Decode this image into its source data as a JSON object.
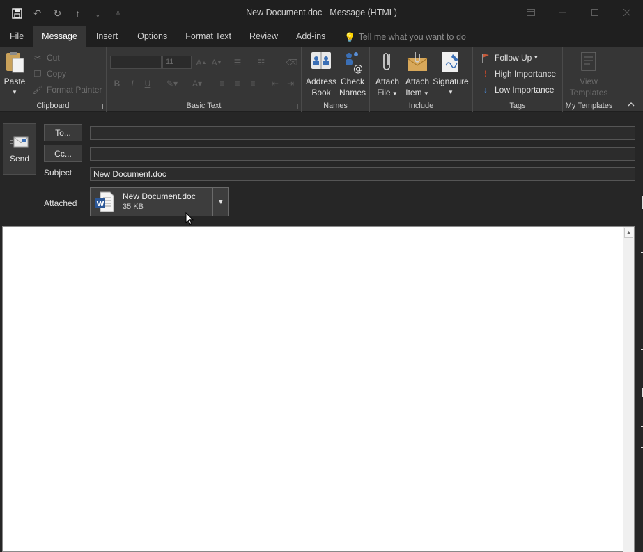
{
  "window": {
    "title": "New Document.doc  -  Message (HTML)"
  },
  "tabs": [
    {
      "label": "File"
    },
    {
      "label": "Message"
    },
    {
      "label": "Insert"
    },
    {
      "label": "Options"
    },
    {
      "label": "Format Text"
    },
    {
      "label": "Review"
    },
    {
      "label": "Add-ins"
    }
  ],
  "tell_me": "Tell me what you want to do",
  "ribbon": {
    "clipboard": {
      "label": "Clipboard",
      "paste": "Paste",
      "cut": "Cut",
      "copy": "Copy",
      "format_painter": "Format Painter"
    },
    "basic_text": {
      "label": "Basic Text",
      "font_size": "11"
    },
    "names": {
      "label": "Names",
      "address_book_1": "Address",
      "address_book_2": "Book",
      "check_names_1": "Check",
      "check_names_2": "Names"
    },
    "include": {
      "label": "Include",
      "attach_file_1": "Attach",
      "attach_file_2": "File",
      "attach_item_1": "Attach",
      "attach_item_2": "Item",
      "signature": "Signature"
    },
    "tags": {
      "label": "Tags",
      "follow_up": "Follow Up",
      "high_importance": "High Importance",
      "low_importance": "Low Importance"
    },
    "templates": {
      "label": "My Templates",
      "view_1": "View",
      "view_2": "Templates"
    }
  },
  "compose": {
    "send": "Send",
    "to_button": "To...",
    "cc_button": "Cc...",
    "to_value": "",
    "cc_value": "",
    "subject_label": "Subject",
    "subject_value": "New Document.doc",
    "attached_label": "Attached",
    "attachment": {
      "name": "New Document.doc",
      "size": "35 KB"
    }
  },
  "colors": {
    "background": "#262626",
    "ribbon": "#363636",
    "titlebar": "#1f1f1f",
    "body": "#ffffff"
  }
}
